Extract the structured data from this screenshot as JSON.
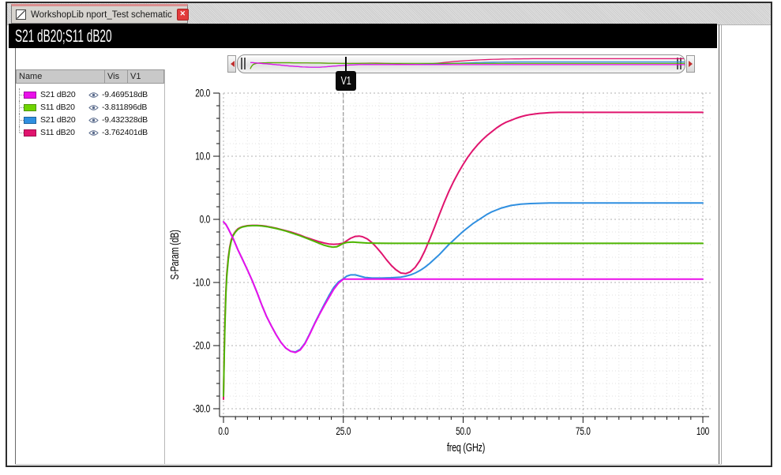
{
  "window": {
    "tab": {
      "title": "WorkshopLib nport_Test schematic",
      "icon": "schematic-icon",
      "close_glyph": "✕"
    }
  },
  "title_bar": {
    "text": "S21 dB20;S11 dB20"
  },
  "legend_panel": {
    "columns": [
      "Name",
      "Vis",
      "V1"
    ],
    "rows": [
      {
        "name": "S21 dB20",
        "color": "#EA0FEA",
        "value": "-9.469518dB",
        "visible": true
      },
      {
        "name": "S11 dB20",
        "color": "#6FD400",
        "value": "-3.811896dB",
        "visible": true
      },
      {
        "name": "S21 dB20",
        "color": "#2F8FE0",
        "value": "-9.432328dB",
        "visible": true
      },
      {
        "name": "S11 dB20",
        "color": "#E0146E",
        "value": "-3.762401dB",
        "visible": true
      }
    ]
  },
  "overview": {
    "marker_label": "V1"
  },
  "chart_data": {
    "type": "line",
    "title": "S21 dB20;S11 dB20",
    "xlabel": "freq (GHz)",
    "ylabel": "S-Param (dB)",
    "xlim": [
      0,
      100
    ],
    "ylim": [
      -30,
      20
    ],
    "x_major_ticks": [
      0,
      25,
      50,
      75,
      100
    ],
    "x_tick_labels": [
      "0.0",
      "25.0",
      "50.0",
      "75.0",
      "100"
    ],
    "x_minor_step": 2.5,
    "y_major_ticks": [
      20,
      10,
      0,
      -10,
      -20,
      -30
    ],
    "y_tick_labels": [
      "20.0",
      "10.0",
      "0.0",
      "-10.0",
      "-20.0",
      "-30.0"
    ],
    "y_minor_step": 2,
    "grid": "dotted",
    "marker": {
      "label": "V1",
      "freq": 25
    },
    "series": [
      {
        "name": "S11 dB20",
        "color": "#E0146E",
        "points": [
          [
            0,
            -28.5
          ],
          [
            0.15,
            -21
          ],
          [
            0.3,
            -16
          ],
          [
            0.5,
            -11.5
          ],
          [
            0.7,
            -8.6
          ],
          [
            1,
            -6.0
          ],
          [
            1.3,
            -4.4
          ],
          [
            1.6,
            -3.3
          ],
          [
            2,
            -2.5
          ],
          [
            2.5,
            -1.9
          ],
          [
            3,
            -1.5
          ],
          [
            3.5,
            -1.3
          ],
          [
            4,
            -1.15
          ],
          [
            5,
            -1.0
          ],
          [
            6,
            -0.95
          ],
          [
            7,
            -0.95
          ],
          [
            8,
            -1.0
          ],
          [
            9,
            -1.1
          ],
          [
            10,
            -1.25
          ],
          [
            11,
            -1.4
          ],
          [
            12,
            -1.6
          ],
          [
            13,
            -1.8
          ],
          [
            14,
            -2.0
          ],
          [
            15,
            -2.25
          ],
          [
            16,
            -2.5
          ],
          [
            17,
            -2.8
          ],
          [
            18,
            -3.05
          ],
          [
            19,
            -3.3
          ],
          [
            20,
            -3.55
          ],
          [
            21,
            -3.75
          ],
          [
            22,
            -3.9
          ],
          [
            23,
            -3.95
          ],
          [
            24,
            -3.9
          ],
          [
            25,
            -3.76
          ],
          [
            25.7,
            -3.4
          ],
          [
            26.5,
            -3.0
          ],
          [
            27.5,
            -2.7
          ],
          [
            28.3,
            -2.65
          ],
          [
            29,
            -2.75
          ],
          [
            30,
            -3.1
          ],
          [
            31,
            -3.7
          ],
          [
            32,
            -4.5
          ],
          [
            33,
            -5.4
          ],
          [
            34,
            -6.4
          ],
          [
            35,
            -7.3
          ],
          [
            36,
            -8.0
          ],
          [
            37,
            -8.5
          ],
          [
            38,
            -8.6
          ],
          [
            39,
            -8.3
          ],
          [
            40,
            -7.6
          ],
          [
            41,
            -6.5
          ],
          [
            42,
            -5.0
          ],
          [
            43,
            -3.2
          ],
          [
            44,
            -1.3
          ],
          [
            45,
            0.7
          ],
          [
            46,
            2.6
          ],
          [
            47,
            4.4
          ],
          [
            48,
            6.0
          ],
          [
            49,
            7.4
          ],
          [
            50,
            8.7
          ],
          [
            51,
            9.9
          ],
          [
            52,
            10.9
          ],
          [
            53,
            11.8
          ],
          [
            54,
            12.6
          ],
          [
            55,
            13.3
          ],
          [
            56,
            13.9
          ],
          [
            57,
            14.5
          ],
          [
            58,
            15.0
          ],
          [
            59,
            15.4
          ],
          [
            60,
            15.7
          ],
          [
            61,
            16.0
          ],
          [
            62,
            16.25
          ],
          [
            63,
            16.45
          ],
          [
            64,
            16.6
          ],
          [
            65,
            16.7
          ],
          [
            66,
            16.8
          ],
          [
            67,
            16.85
          ],
          [
            68,
            16.9
          ],
          [
            70,
            16.95
          ],
          [
            100,
            16.95
          ]
        ]
      },
      {
        "name": "S21 dB20",
        "color": "#2F8FE0",
        "points": [
          [
            0,
            -0.4
          ],
          [
            0.5,
            -0.8
          ],
          [
            1,
            -1.5
          ],
          [
            2,
            -3
          ],
          [
            3,
            -4.8
          ],
          [
            4,
            -6.4
          ],
          [
            5,
            -8
          ],
          [
            6,
            -9.7
          ],
          [
            7,
            -11.6
          ],
          [
            8,
            -13.6
          ],
          [
            9,
            -15.4
          ],
          [
            10,
            -16.9
          ],
          [
            11,
            -18.3
          ],
          [
            12,
            -19.5
          ],
          [
            13,
            -20.4
          ],
          [
            14,
            -20.9
          ],
          [
            15,
            -21.0
          ],
          [
            16,
            -20.6
          ],
          [
            17,
            -19.6
          ],
          [
            18,
            -18.1
          ],
          [
            19,
            -16.5
          ],
          [
            20,
            -15.0
          ],
          [
            21,
            -13.5
          ],
          [
            22,
            -12.1
          ],
          [
            23,
            -10.8
          ],
          [
            24,
            -9.9
          ],
          [
            25,
            -9.43
          ],
          [
            25.7,
            -9.0
          ],
          [
            26.5,
            -8.8
          ],
          [
            27.5,
            -8.8
          ],
          [
            28.5,
            -9.0
          ],
          [
            29.5,
            -9.2
          ],
          [
            31,
            -9.3
          ],
          [
            33,
            -9.3
          ],
          [
            35,
            -9.25
          ],
          [
            37,
            -9.15
          ],
          [
            38,
            -9.0
          ],
          [
            39,
            -8.8
          ],
          [
            40,
            -8.5
          ],
          [
            41,
            -8.1
          ],
          [
            42,
            -7.6
          ],
          [
            43,
            -7.0
          ],
          [
            44,
            -6.3
          ],
          [
            45,
            -5.6
          ],
          [
            46,
            -4.8
          ],
          [
            47,
            -4.0
          ],
          [
            48,
            -3.3
          ],
          [
            49,
            -2.6
          ],
          [
            50,
            -1.9
          ],
          [
            51,
            -1.3
          ],
          [
            52,
            -0.7
          ],
          [
            53,
            -0.2
          ],
          [
            54,
            0.3
          ],
          [
            55,
            0.8
          ],
          [
            56,
            1.2
          ],
          [
            57,
            1.5
          ],
          [
            58,
            1.8
          ],
          [
            59,
            2.0
          ],
          [
            60,
            2.2
          ],
          [
            62,
            2.4
          ],
          [
            64,
            2.5
          ],
          [
            66,
            2.55
          ],
          [
            68,
            2.6
          ],
          [
            70,
            2.6
          ],
          [
            100,
            2.6
          ]
        ]
      },
      {
        "name": "S11 dB20",
        "color": "#4DB500",
        "points": [
          [
            0,
            -28
          ],
          [
            0.15,
            -22
          ],
          [
            0.3,
            -17
          ],
          [
            0.5,
            -12
          ],
          [
            0.7,
            -9
          ],
          [
            1,
            -6.3
          ],
          [
            1.3,
            -4.6
          ],
          [
            1.6,
            -3.5
          ],
          [
            2,
            -2.6
          ],
          [
            2.5,
            -2.0
          ],
          [
            3,
            -1.6
          ],
          [
            3.5,
            -1.35
          ],
          [
            4,
            -1.2
          ],
          [
            5,
            -1.05
          ],
          [
            6,
            -1.0
          ],
          [
            7,
            -1.0
          ],
          [
            8,
            -1.05
          ],
          [
            9,
            -1.15
          ],
          [
            10,
            -1.3
          ],
          [
            11,
            -1.45
          ],
          [
            12,
            -1.65
          ],
          [
            13,
            -1.85
          ],
          [
            14,
            -2.1
          ],
          [
            15,
            -2.35
          ],
          [
            16,
            -2.6
          ],
          [
            17,
            -2.9
          ],
          [
            18,
            -3.2
          ],
          [
            19,
            -3.5
          ],
          [
            20,
            -3.8
          ],
          [
            21,
            -4.1
          ],
          [
            22,
            -4.3
          ],
          [
            22.8,
            -4.4
          ],
          [
            23.6,
            -4.35
          ],
          [
            24.3,
            -4.1
          ],
          [
            25,
            -3.81
          ],
          [
            25.8,
            -3.65
          ],
          [
            27,
            -3.6
          ],
          [
            28,
            -3.65
          ],
          [
            29,
            -3.7
          ],
          [
            30,
            -3.75
          ],
          [
            32,
            -3.78
          ],
          [
            35,
            -3.8
          ],
          [
            100,
            -3.8
          ]
        ]
      },
      {
        "name": "S21 dB20",
        "color": "#EA0FEA",
        "points": [
          [
            0,
            -0.4
          ],
          [
            0.5,
            -0.8
          ],
          [
            1,
            -1.5
          ],
          [
            2,
            -3
          ],
          [
            3,
            -4.8
          ],
          [
            4,
            -6.4
          ],
          [
            5,
            -8
          ],
          [
            6,
            -9.7
          ],
          [
            7,
            -11.6
          ],
          [
            8,
            -13.6
          ],
          [
            9,
            -15.4
          ],
          [
            10,
            -16.9
          ],
          [
            11,
            -18.3
          ],
          [
            12,
            -19.5
          ],
          [
            13,
            -20.4
          ],
          [
            14,
            -20.9
          ],
          [
            15,
            -21.1
          ],
          [
            16,
            -20.7
          ],
          [
            17,
            -19.7
          ],
          [
            18,
            -18.2
          ],
          [
            19,
            -16.6
          ],
          [
            20,
            -15.1
          ],
          [
            21,
            -13.7
          ],
          [
            22,
            -12.4
          ],
          [
            23,
            -11.1
          ],
          [
            24,
            -10.1
          ],
          [
            25,
            -9.47
          ],
          [
            27,
            -9.47
          ],
          [
            100,
            -9.47
          ]
        ]
      }
    ]
  }
}
